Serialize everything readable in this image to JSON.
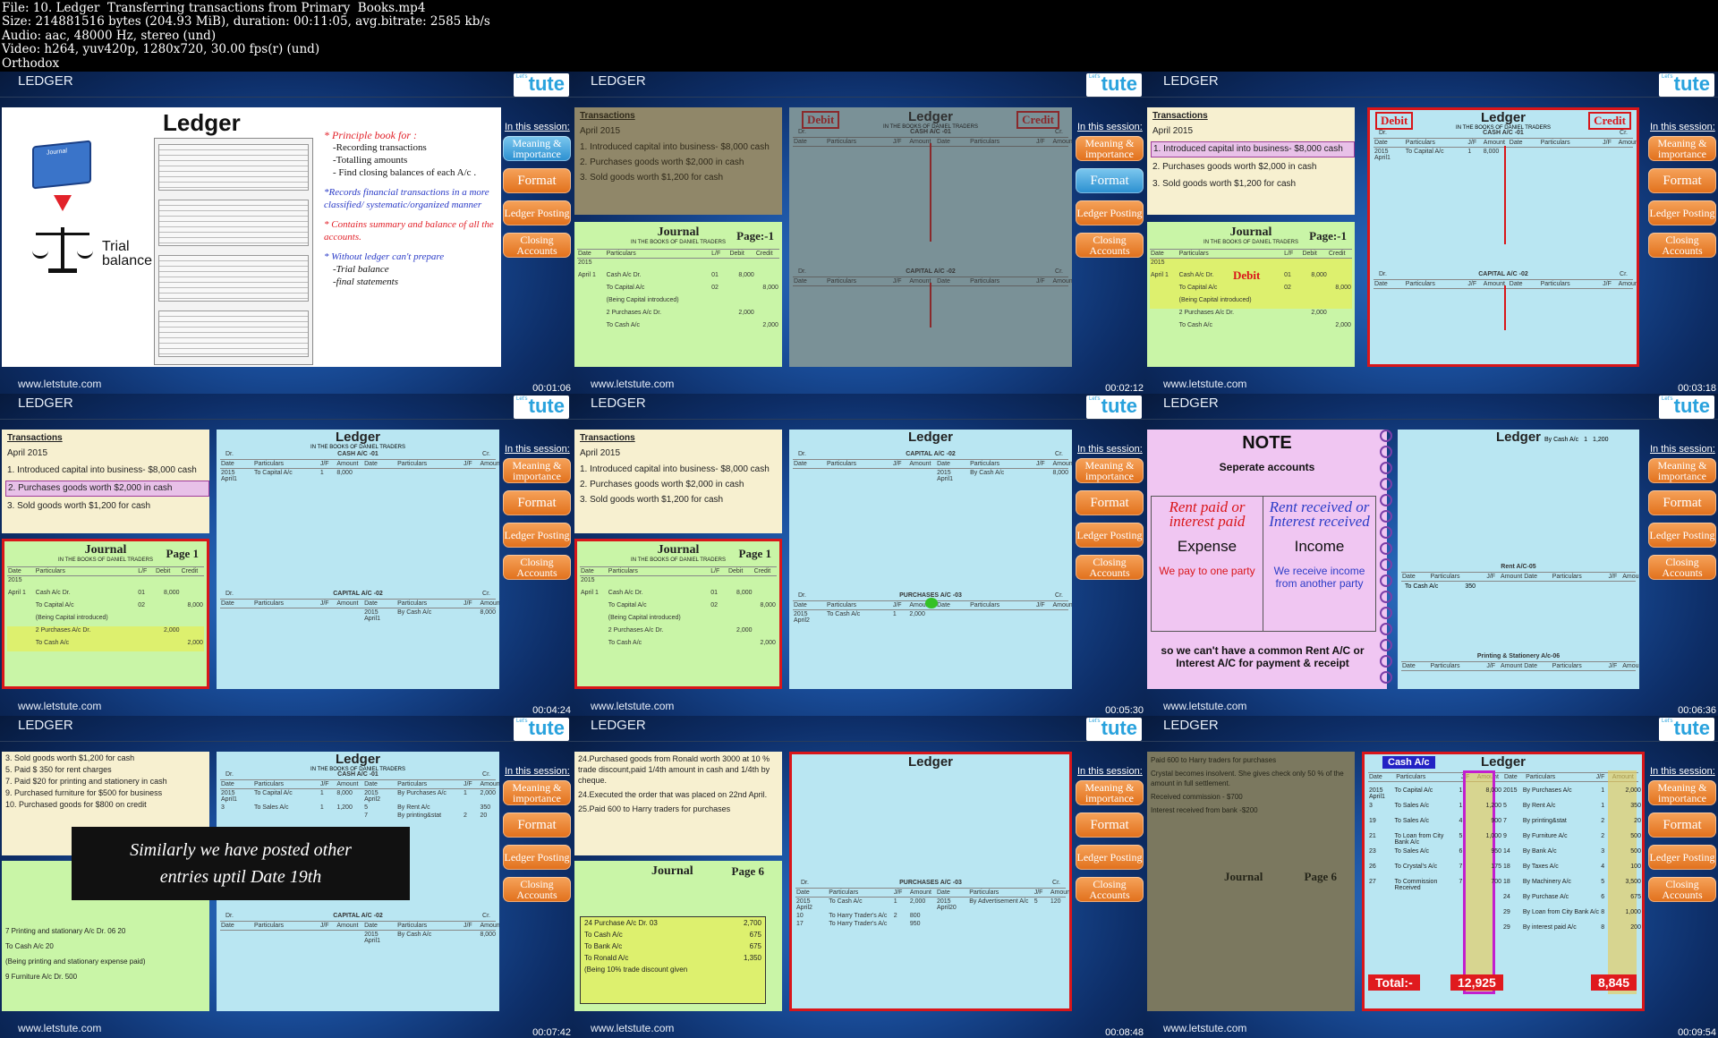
{
  "info": [
    "File: 10. Ledger  Transferring transactions from Primary  Books.mp4",
    "Size: 214881516 bytes (204.93 MiB), duration: 00:11:05, avg.bitrate: 2585 kb/s",
    "Audio: aac, 48000 Hz, stereo (und)",
    "Video: h264, yuv420p, 1280x720, 30.00 fps(r) (und)",
    "Orthodox"
  ],
  "common": {
    "video_title": "LEDGER",
    "site": "www.letstute.com",
    "logo_small": "Let's",
    "logo": "tute",
    "in_session": "In this session:",
    "menu": [
      "Meaning & importance",
      "Format",
      "Ledger Posting",
      "Closing Accounts"
    ]
  },
  "timestamps": [
    "00:01:06",
    "00:02:12",
    "00:03:18",
    "00:04:24",
    "00:05:30",
    "00:06:36",
    "00:07:42",
    "00:08:48",
    "00:09:54"
  ],
  "f1": {
    "title": "Ledger",
    "book": "Journal",
    "trial": "Trial balance",
    "points": [
      "* Principle book for :",
      "-Recording transactions",
      "-Totalling amounts",
      "- Find closing balances of each A/c .",
      "*Records financial transactions in a more classified/ systematic/organized manner",
      "* Contains summary and balance of all the accounts.",
      "* Without ledger can't prepare",
      "-Trial balance",
      "-final statements"
    ]
  },
  "transactions": {
    "heading": "Transactions",
    "month": "April 2015",
    "items": [
      "1.  Introduced capital into business- $8,000 cash",
      "2.  Purchases goods worth $2,000 in cash",
      "3.  Sold goods worth $1,200 for cash"
    ]
  },
  "journal": {
    "title": "Journal",
    "books": "IN THE BOOKS OF DANIEL TRADERS",
    "page1": "Page:-1",
    "page1b": "Page 1",
    "cols": [
      "Date",
      "Particulars",
      "L/F",
      "Debit",
      "Credit"
    ],
    "rows": [
      [
        "2015",
        "",
        "",
        "",
        ""
      ],
      [
        "April 1",
        "Cash A/c                 Dr.",
        "01",
        "8,000",
        ""
      ],
      [
        "",
        "To Capital A/c",
        "02",
        "",
        "8,000"
      ],
      [
        "",
        "(Being Capital introduced)",
        "",
        "",
        ""
      ],
      [
        "",
        "2 Purchases A/c       Dr.",
        "",
        "2,000",
        ""
      ],
      [
        "",
        "To Cash A/c",
        "",
        "",
        "2,000"
      ]
    ]
  },
  "ledger": {
    "title": "Ledger",
    "books": "IN THE BOOKS OF DANIEL TRADERS",
    "debit": "Debit",
    "credit": "Credit",
    "cash": "CASH A/C   -01",
    "capital": "CAPITAL A/C -02",
    "purchases": "PURCHASES A/C -03",
    "dr": "Dr.",
    "cr": "Cr.",
    "cols": [
      "Date",
      "Particulars",
      "J/F",
      "Amount",
      "Date",
      "Particulars",
      "J/F",
      "Amount"
    ],
    "cash_row": [
      "2015 April1",
      "To Capital A/c",
      "1",
      "8,000"
    ],
    "capital_row": [
      "2015 April1",
      "By Cash A/c",
      "",
      "8,000"
    ]
  },
  "f6": {
    "note": "NOTE",
    "sep": "Seperate accounts",
    "left_title": "Rent paid or interest paid",
    "left_kind": "Expense",
    "left_desc": "We pay to one party",
    "right_title": "Rent received or Interest received",
    "right_kind": "Income",
    "right_desc": "We receive income from another party",
    "footer": "so we can't have a common Rent A/C or Interest A/C for payment & receipt",
    "rent": "Rent A/C-05",
    "printing": "Printing & Stationery A/c-06",
    "rent_row": [
      "To Cash A/c",
      "350"
    ],
    "top_row": [
      "By Cash A/c",
      "1",
      "1,200"
    ]
  },
  "f7": {
    "items": [
      "3.   Sold goods worth $1,200 for cash",
      "5.   Paid $ 350 for rent charges",
      "7.   Paid $20 for printing and stationery in cash",
      "9.   Purchased furniture for $500 for business",
      "10.   Purchased goods for $800 on credit"
    ],
    "banner": "Similarly we have posted other entries uptil Date 19th",
    "cash_rows": [
      [
        "2015 April1",
        "To Capital A/c",
        "1",
        "8,000",
        "2015 April2",
        "By Purchases A/c",
        "1",
        "2,000"
      ],
      [
        "3",
        "To Sales A/c",
        "1",
        "1,200",
        "5",
        "By Rent A/c",
        "",
        "350"
      ],
      [
        "",
        "",
        "",
        "",
        "7",
        "By printing&stat",
        "2",
        "20"
      ]
    ],
    "jrows": [
      "7  Printing and stationary A/c Dr.   06   20",
      "To Cash  A/c                                    20",
      "(Being printing and stationary expense paid)",
      "9  Furniture A/c              Dr.        500"
    ]
  },
  "f8": {
    "items": [
      "24.Purchased goods from Ronald worth 3000 at 10 % trade discount,paid 1/4th amount in cash and 1/4th by cheque.",
      "24.Executed the order that was placed on 22nd April.",
      "25.Paid 600 to Harry traders for purchases"
    ],
    "page": "Page 6",
    "jrows": [
      [
        "24 Purchase A/c      Dr.  03",
        "2,700"
      ],
      [
        "To Cash A/c",
        "675"
      ],
      [
        "To Bank A/c",
        "675"
      ],
      [
        "To Ronald A/c",
        "1,350"
      ],
      [
        "(Being 10% trade discount given",
        ""
      ]
    ],
    "prows": [
      [
        "2015 April2",
        "To Cash A/c",
        "1",
        "2,000",
        "2015 April20",
        "By Advertisement A/c",
        "5",
        "120"
      ],
      [
        "10",
        "To Harry Trader's A/c",
        "2",
        "800",
        "",
        "",
        "",
        ""
      ],
      [
        "17",
        "To Harry Trader's A/c",
        "",
        "950",
        "",
        "",
        "",
        ""
      ]
    ]
  },
  "f9": {
    "tag": "Cash A/c",
    "dr_rows": [
      [
        "2015 April1",
        "To Capital A/c",
        "1",
        "8,000"
      ],
      [
        "3",
        "To Sales A/c",
        "1",
        "1,200"
      ],
      [
        "19",
        "To Sales A/c",
        "4",
        "900"
      ],
      [
        "21",
        "To Loan from City Bank A/c",
        "5",
        "1,000"
      ],
      [
        "23",
        "To Sales A/c",
        "6",
        "950"
      ],
      [
        "26",
        "To Crystal's A/c",
        "7",
        "175"
      ],
      [
        "27",
        "To Commission Received",
        "7",
        "700"
      ]
    ],
    "cr_rows": [
      [
        "2015",
        "By Purchases A/c",
        "1",
        "2,000"
      ],
      [
        "5",
        "By Rent A/c",
        "1",
        "350"
      ],
      [
        "7",
        "By printing&stat",
        "2",
        "20"
      ],
      [
        "9",
        "By Furniture A/c",
        "2",
        "500"
      ],
      [
        "14",
        "By Bank A/c",
        "3",
        "500"
      ],
      [
        "18",
        "By Taxes A/c",
        "4",
        "100"
      ],
      [
        "18",
        "By Machinery A/c",
        "5",
        "3,500"
      ],
      [
        "24",
        "By Purchase A/c",
        "6",
        "675"
      ],
      [
        "29",
        "By Loan from City Bank A/c",
        "8",
        "1,000"
      ],
      [
        "29",
        "By interest paid A/c",
        "8",
        "200"
      ]
    ],
    "total_label": "Total:-",
    "total_dr": "12,925",
    "total_cr": "8,845",
    "bg_items": [
      "Paid 600 to Harry traders for purchases",
      "Crystal becomes insolvent. She gives check only 50 % of the amount in full settlement.",
      "Received commission - $700",
      "Interest received from bank -$200"
    ]
  }
}
